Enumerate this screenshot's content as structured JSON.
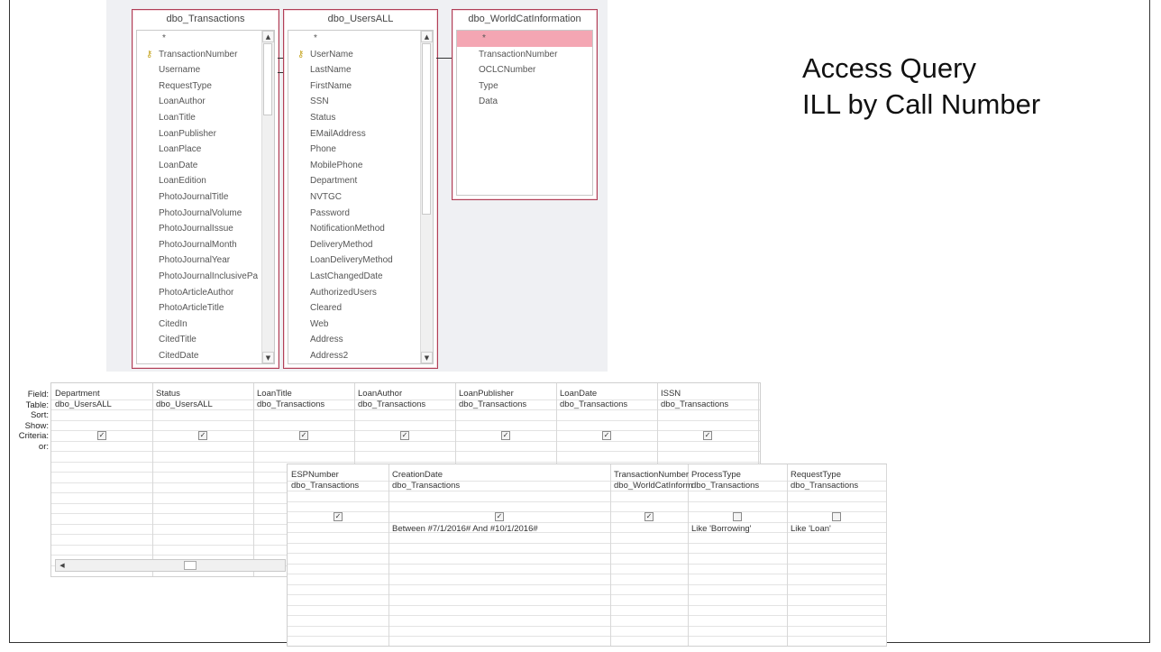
{
  "title_lines": [
    "Access Query",
    "ILL by Call Number"
  ],
  "tables": [
    {
      "name": "dbo_Transactions",
      "fields": [
        "*",
        "TransactionNumber",
        "Username",
        "RequestType",
        "LoanAuthor",
        "LoanTitle",
        "LoanPublisher",
        "LoanPlace",
        "LoanDate",
        "LoanEdition",
        "PhotoJournalTitle",
        "PhotoJournalVolume",
        "PhotoJournalIssue",
        "PhotoJournalMonth",
        "PhotoJournalYear",
        "PhotoJournalInclusivePa",
        "PhotoArticleAuthor",
        "PhotoArticleTitle",
        "CitedIn",
        "CitedTitle",
        "CitedDate"
      ],
      "key_field": "TransactionNumber"
    },
    {
      "name": "dbo_UsersALL",
      "fields": [
        "*",
        "UserName",
        "LastName",
        "FirstName",
        "SSN",
        "Status",
        "EMailAddress",
        "Phone",
        "MobilePhone",
        "Department",
        "NVTGC",
        "Password",
        "NotificationMethod",
        "DeliveryMethod",
        "LoanDeliveryMethod",
        "LastChangedDate",
        "AuthorizedUsers",
        "Cleared",
        "Web",
        "Address",
        "Address2"
      ],
      "key_field": "UserName"
    },
    {
      "name": "dbo_WorldCatInformation",
      "fields": [
        "*",
        "TransactionNumber",
        "OCLCNumber",
        "Type",
        "Data"
      ],
      "selected_field": "*"
    }
  ],
  "row_labels": [
    "Field:",
    "Table:",
    "Sort:",
    "Show:",
    "Criteria:",
    "or:"
  ],
  "grid_top": [
    {
      "field": "Department",
      "table": "dbo_UsersALL",
      "show": true,
      "criteria": ""
    },
    {
      "field": "Status",
      "table": "dbo_UsersALL",
      "show": true,
      "criteria": ""
    },
    {
      "field": "LoanTitle",
      "table": "dbo_Transactions",
      "show": true,
      "criteria": ""
    },
    {
      "field": "LoanAuthor",
      "table": "dbo_Transactions",
      "show": true,
      "criteria": ""
    },
    {
      "field": "LoanPublisher",
      "table": "dbo_Transactions",
      "show": true,
      "criteria": ""
    },
    {
      "field": "LoanDate",
      "table": "dbo_Transactions",
      "show": true,
      "criteria": ""
    },
    {
      "field": "ISSN",
      "table": "dbo_Transactions",
      "show": true,
      "criteria": ""
    }
  ],
  "grid_bottom": [
    {
      "field": "ESPNumber",
      "table": "dbo_Transactions",
      "show": true,
      "criteria": ""
    },
    {
      "field": "CreationDate",
      "table": "dbo_Transactions",
      "show": true,
      "criteria": "Between #7/1/2016# And #10/1/2016#"
    },
    {
      "field": "TransactionNumber",
      "table": "dbo_WorldCatInform",
      "show": true,
      "criteria": ""
    },
    {
      "field": "ProcessType",
      "table": "dbo_Transactions",
      "show": false,
      "criteria": "Like 'Borrowing'"
    },
    {
      "field": "RequestType",
      "table": "dbo_Transactions",
      "show": false,
      "criteria": "Like 'Loan'"
    }
  ],
  "glyphs": {
    "key": "⚷",
    "check": "✓",
    "up": "▲",
    "down": "▼",
    "left": "◀"
  },
  "colors": {
    "table_border": "#b03f57",
    "selected_row": "#f4a6b3",
    "canvas": "#eff0f3"
  }
}
